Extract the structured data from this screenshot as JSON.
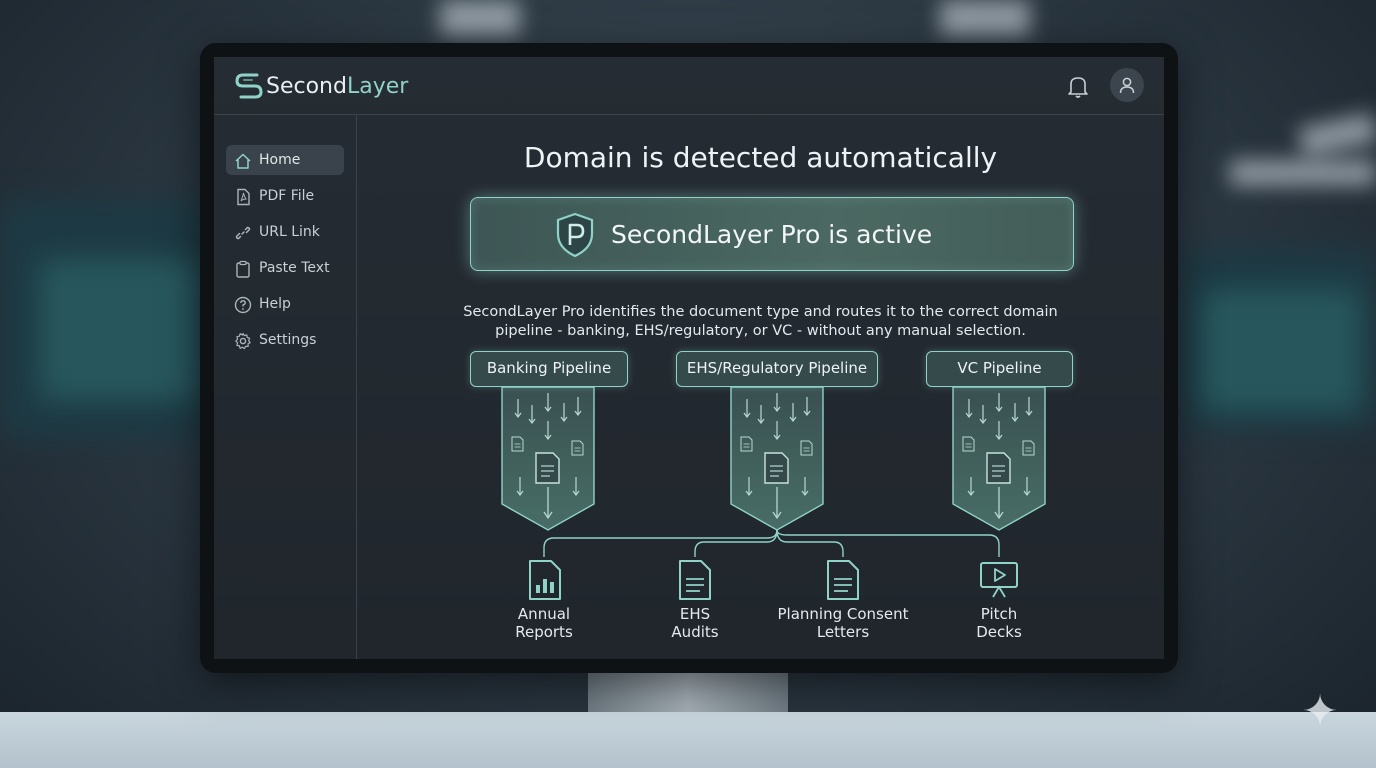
{
  "app": {
    "brand_part1": "Second",
    "brand_part2": "Layer"
  },
  "header": {
    "icons": [
      "logo-icon",
      "bell-icon",
      "user-icon"
    ]
  },
  "sidebar": {
    "items": [
      {
        "label": "Home",
        "icon": "home-icon",
        "active": true
      },
      {
        "label": "PDF File",
        "icon": "pdf-icon",
        "active": false
      },
      {
        "label": "URL Link",
        "icon": "link-icon",
        "active": false
      },
      {
        "label": "Paste Text",
        "icon": "clipboard-icon",
        "active": false
      },
      {
        "label": "Help",
        "icon": "help-icon",
        "active": false
      },
      {
        "label": "Settings",
        "icon": "gear-icon",
        "active": false
      }
    ]
  },
  "main": {
    "title": "Domain is detected automatically",
    "banner": "SecondLayer Pro is active",
    "description_line1": "SecondLayer Pro identifies the document type and routes it to the correct domain",
    "description_line2": "pipeline - banking, EHS/regulatory, or VC - without any manual selection.",
    "pipelines": [
      "Banking Pipeline",
      "EHS/Regulatory Pipeline",
      "VC Pipeline"
    ],
    "outputs": [
      {
        "line1": "Annual",
        "line2": "Reports",
        "icon": "chart-document-icon"
      },
      {
        "line1": "EHS",
        "line2": "Audits",
        "icon": "document-icon"
      },
      {
        "line1": "Planning Consent",
        "line2": "Letters",
        "icon": "document-icon"
      },
      {
        "line1": "Pitch",
        "line2": "Decks",
        "icon": "presentation-icon"
      }
    ]
  },
  "colors": {
    "accent": "#8fd2c8",
    "panel": "#252c33",
    "text": "#e3e9ec"
  }
}
